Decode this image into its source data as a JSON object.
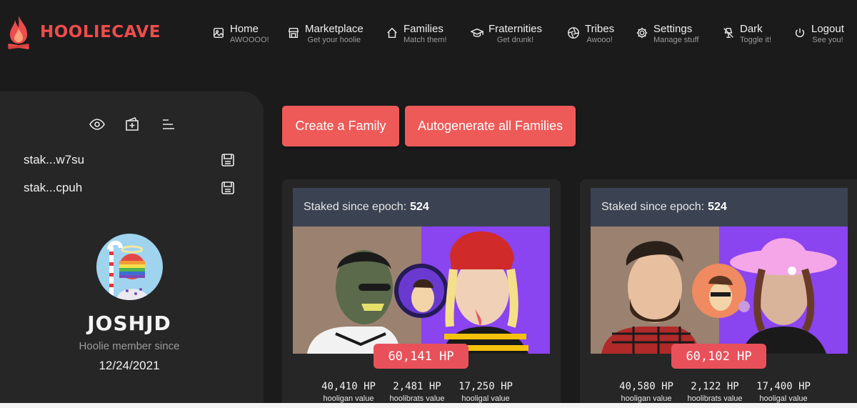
{
  "brand": {
    "name": "HOOLIECAVE",
    "accent": "#ee4c4c"
  },
  "nav": [
    {
      "label": "Home",
      "sub": "AWOOOO!",
      "icon": "image-icon"
    },
    {
      "label": "Marketplace",
      "sub": "Get your hoolie",
      "icon": "store-icon"
    },
    {
      "label": "Families",
      "sub": "Match them!",
      "icon": "house-icon"
    },
    {
      "label": "Fraternities",
      "sub": "Get drunk!",
      "icon": "graduation-cap-icon"
    },
    {
      "label": "Tribes",
      "sub": "Awooo!",
      "icon": "aperture-icon"
    },
    {
      "label": "Settings",
      "sub": "Manage stuff",
      "icon": "gear-icon"
    },
    {
      "label": "Dark",
      "sub": "Toggle it!",
      "icon": "lamp-off-icon"
    },
    {
      "label": "Logout",
      "sub": "See you!",
      "icon": "power-icon"
    }
  ],
  "sidebar": {
    "stake_keys": [
      "stak...w7su",
      "stak...cpuh"
    ],
    "username": "JOSHJD",
    "member_since_label": "Hoolie member since",
    "member_since_date": "12/24/2021"
  },
  "actions": {
    "create_family": "Create a Family",
    "autogenerate": "Autogenerate all Families"
  },
  "families": [
    {
      "staked_label": "Staked since epoch:",
      "epoch": "524",
      "hp": "60,141 HP",
      "stats": [
        {
          "value": "40,410 HP",
          "label": "hooligan value"
        },
        {
          "value": "2,481 HP",
          "label": "hoolibrats value"
        },
        {
          "value": "17,250 HP",
          "label": "hooligal value"
        }
      ]
    },
    {
      "staked_label": "Staked since epoch:",
      "epoch": "524",
      "hp": "60,102 HP",
      "stats": [
        {
          "value": "40,580 HP",
          "label": "hooligan value"
        },
        {
          "value": "2,122 HP",
          "label": "hoolibrats value"
        },
        {
          "value": "17,400 HP",
          "label": "hooligal value"
        }
      ]
    }
  ]
}
